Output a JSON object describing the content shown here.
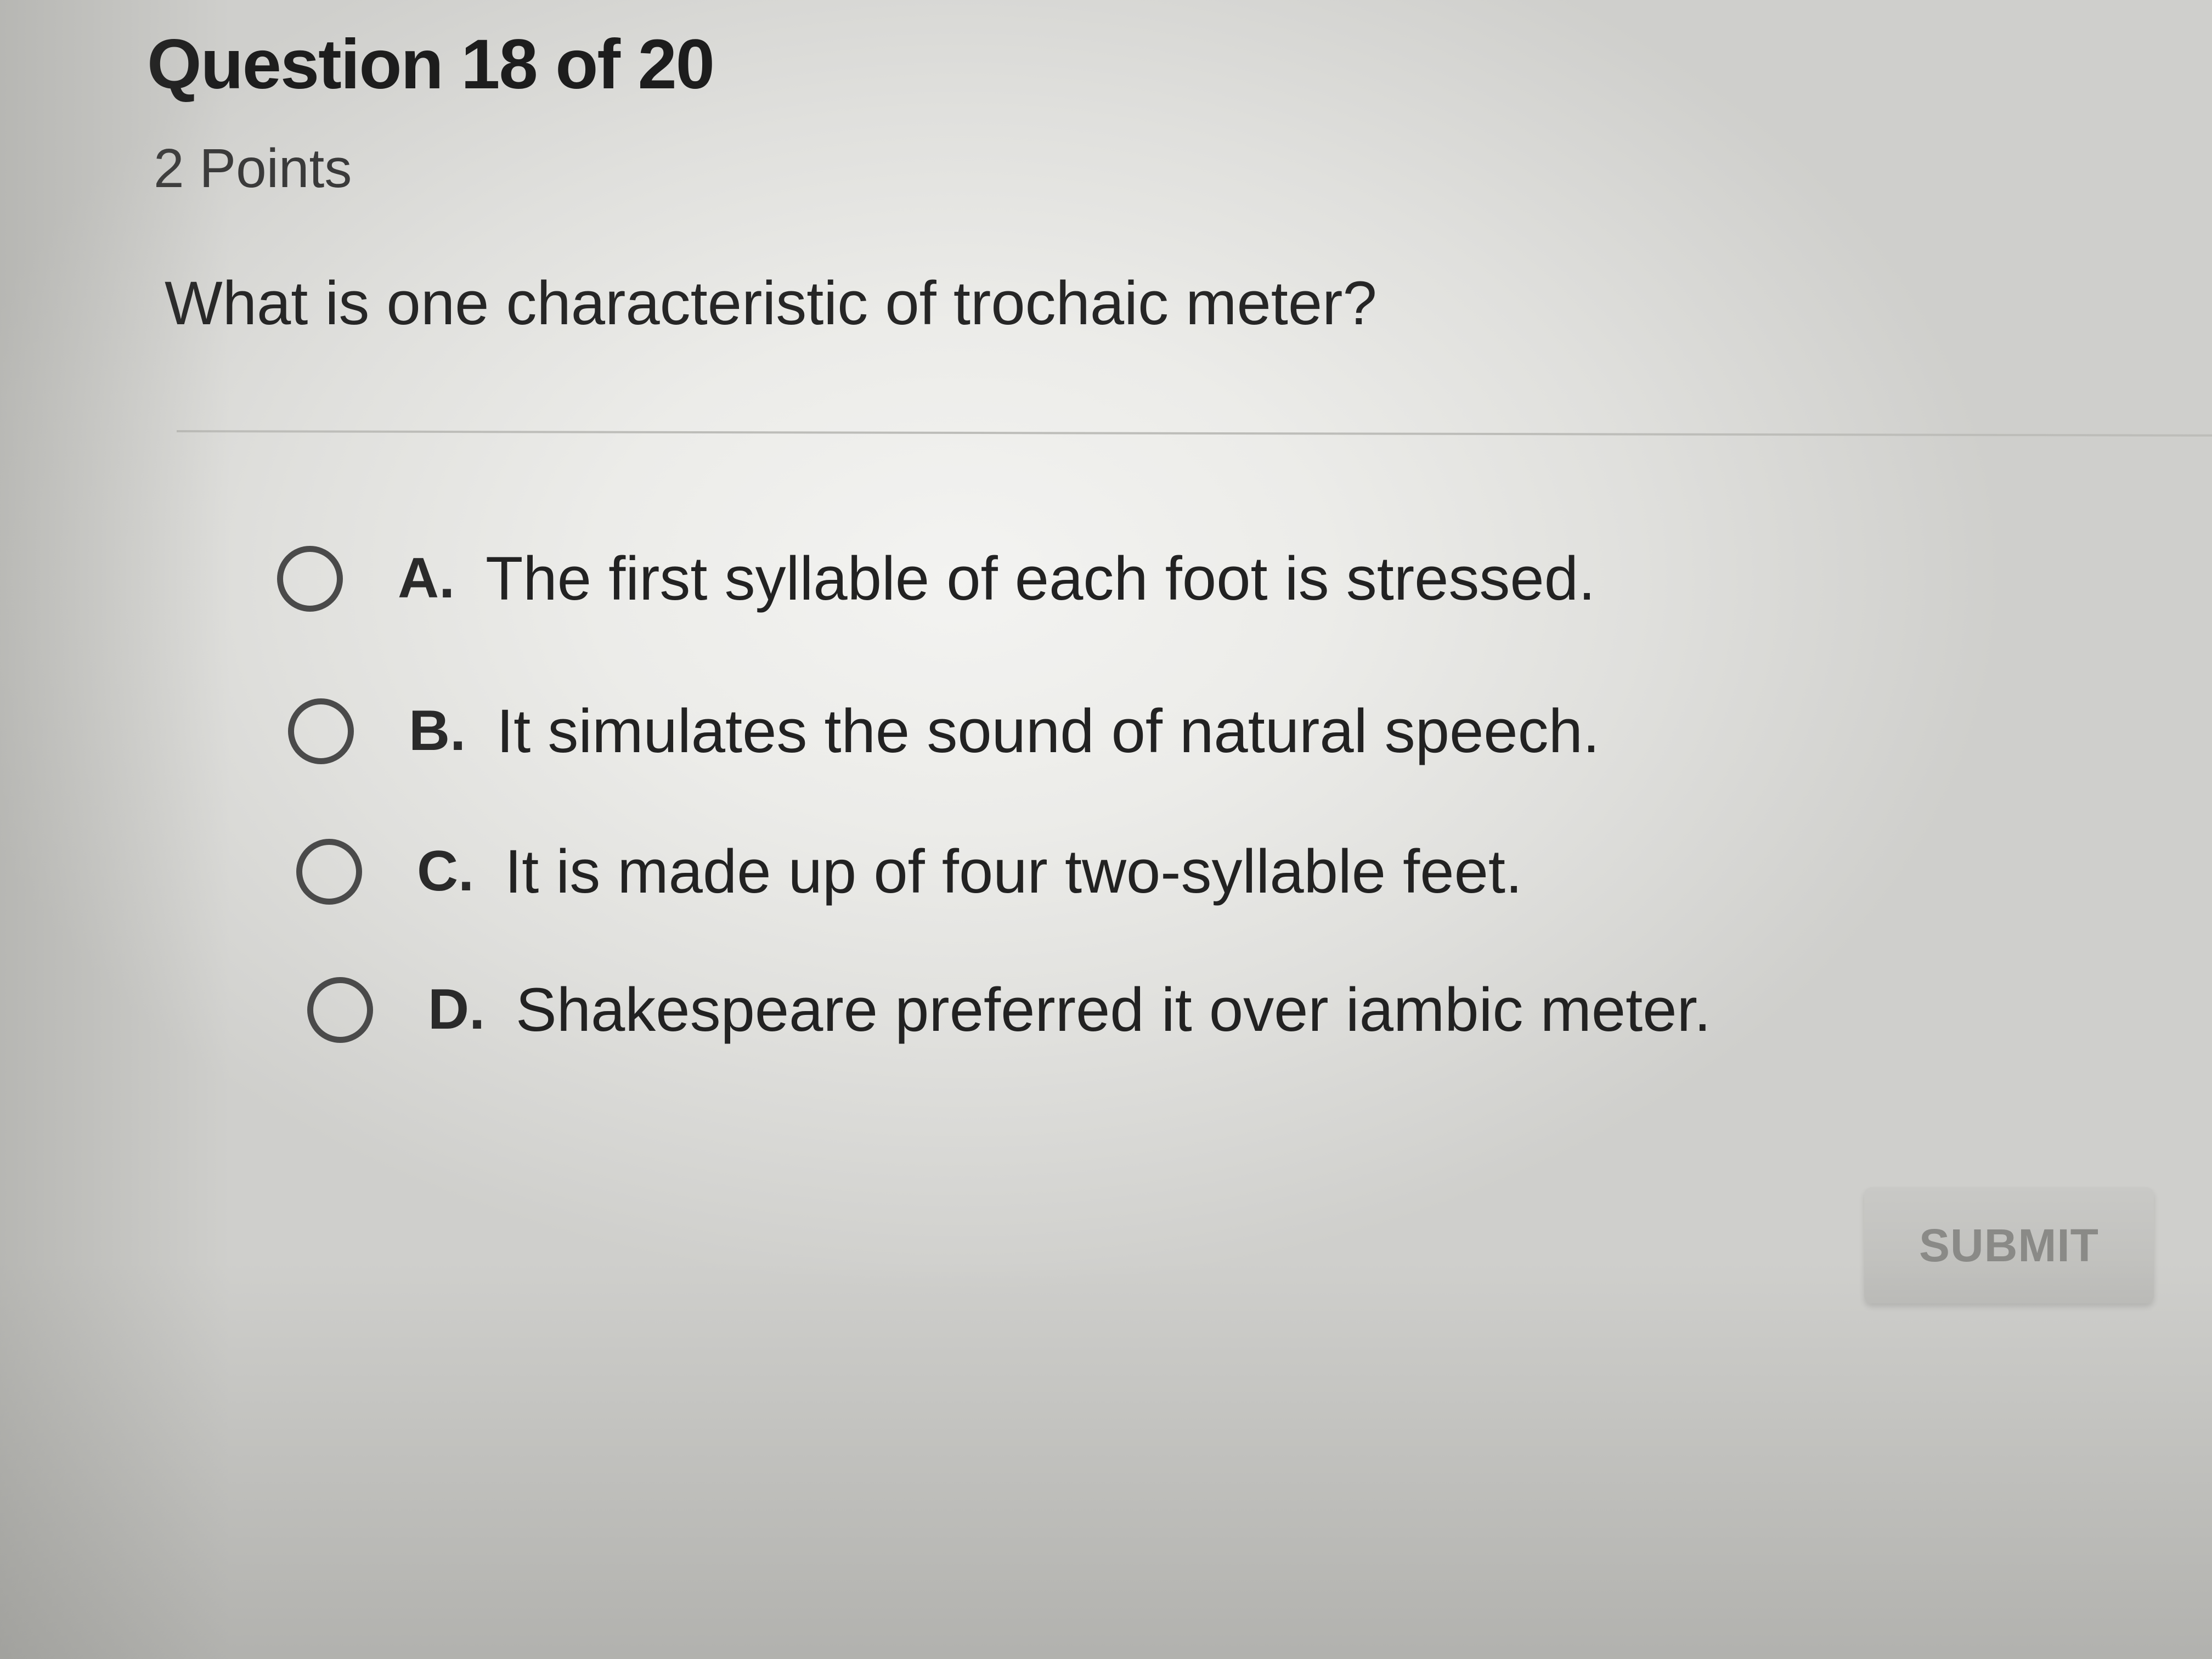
{
  "quiz": {
    "header": "Question 18 of 20",
    "points": "2 Points",
    "prompt": "What is one characteristic of trochaic meter?",
    "options": [
      {
        "letter": "A.",
        "text": "The first syllable of each foot is stressed."
      },
      {
        "letter": "B.",
        "text": "It simulates the sound of natural speech."
      },
      {
        "letter": "C.",
        "text": "It is made up of four two-syllable feet."
      },
      {
        "letter": "D.",
        "text": "Shakespeare preferred it over iambic meter."
      }
    ],
    "submit_label": "SUBMIT"
  },
  "colors": {
    "submit_button_bg": "#c4c4c1",
    "submit_text_disabled": "#8a8a87",
    "radio_border": "#4a4a4a"
  },
  "icons": {
    "radio": "radio-unselected-icon"
  }
}
